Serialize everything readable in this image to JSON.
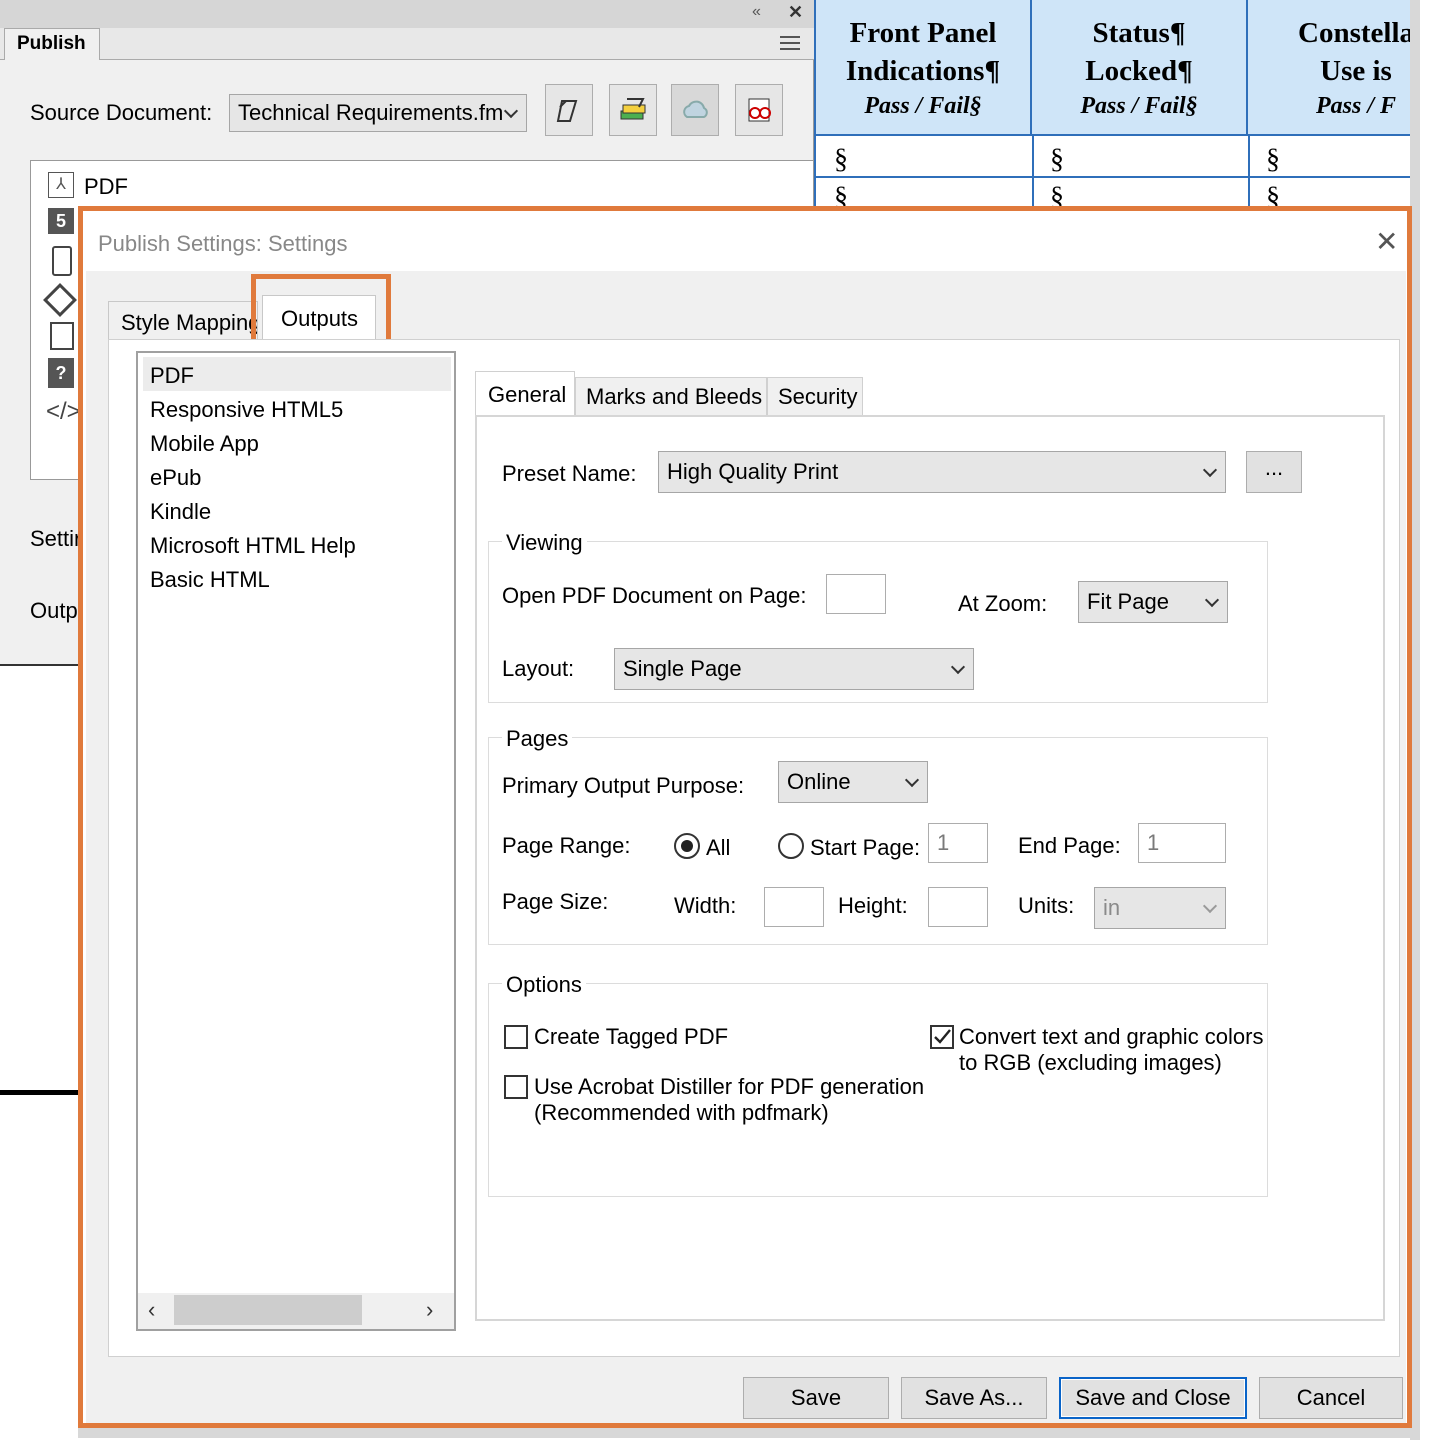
{
  "panel": {
    "tab": "Publish",
    "source_label": "Source Document:",
    "source_value": "Technical Requirements.fm",
    "list_first_item": "PDF",
    "settings_label": "Settir",
    "output_label": "Outpu"
  },
  "table": {
    "headers": [
      {
        "l1": "Front Panel",
        "l2": "Indications¶",
        "l3": "Pass / Fail§"
      },
      {
        "l1": "Status¶",
        "l2": "Locked¶",
        "l3": "Pass / Fail§"
      },
      {
        "l1": "Constella",
        "l2": "Use is",
        "l3": "Pass / F"
      }
    ],
    "cell": "§"
  },
  "dialog": {
    "title": "Publish Settings: Settings",
    "tabs": [
      "Style Mapping",
      "Outputs"
    ],
    "formats": [
      "PDF",
      "Responsive HTML5",
      "Mobile App",
      "ePub",
      "Kindle",
      "Microsoft HTML Help",
      "Basic HTML"
    ],
    "subtabs": [
      "General",
      "Marks and Bleeds",
      "Security"
    ],
    "preset_label": "Preset Name:",
    "preset_value": "High Quality Print",
    "browse_label": "...",
    "viewing": {
      "title": "Viewing",
      "open_label": "Open PDF Document on Page:",
      "open_value": "",
      "zoom_label": "At Zoom:",
      "zoom_value": "Fit Page",
      "layout_label": "Layout:",
      "layout_value": "Single Page"
    },
    "pages": {
      "title": "Pages",
      "purpose_label": "Primary Output Purpose:",
      "purpose_value": "Online",
      "range_label": "Page Range:",
      "all_label": "All",
      "start_label": "Start Page:",
      "start_value": "1",
      "end_label": "End Page:",
      "end_value": "1",
      "size_label": "Page Size:",
      "width_label": "Width:",
      "height_label": "Height:",
      "units_label": "Units:",
      "units_value": "in"
    },
    "options": {
      "title": "Options",
      "tagged_line1": "Create Tagged PDF",
      "distiller_line1": "Use Acrobat Distiller for PDF generation",
      "distiller_line2": "(Recommended with pdfmark)",
      "rgb_line1": "Convert text and graphic colors",
      "rgb_line2": "to RGB (excluding images)"
    },
    "buttons": {
      "save": "Save",
      "save_as": "Save As...",
      "save_close": "Save and Close",
      "cancel": "Cancel"
    }
  },
  "colors": {
    "highlight": "#e07a3c",
    "table_header": "#cfe5f8",
    "table_line": "#2f6fba",
    "primary_button": "#0a64c8"
  }
}
